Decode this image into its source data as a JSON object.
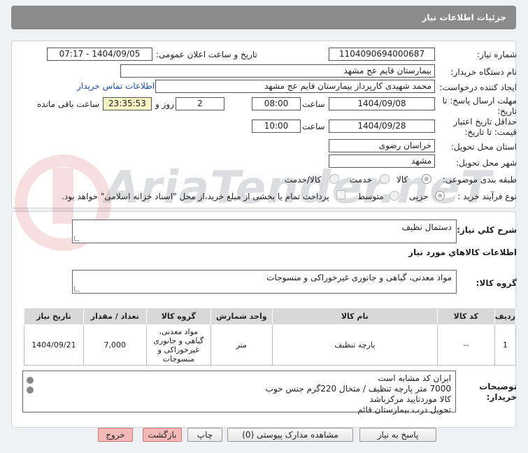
{
  "header": {
    "title": "جزئیات اطلاعات نیاز"
  },
  "form": {
    "need_number_label": "شماره نیاز:",
    "need_number": "1104090694000687",
    "announce_label": "تاریخ و ساعت اعلان عمومی:",
    "announce_value": "1404/09/05 - 07:17",
    "buyer_org_label": "نام دستگاه خریدار:",
    "buyer_org": "بیمارستان قایم  عج  مشهد",
    "creator_label": "ایجاد کننده درخواست:",
    "creator": "محمد شهیدی کارپرداز بیمارستان قایم  عج  مشهد",
    "contact_link": "اطلاعات تماس خریدار",
    "send_deadline_label_1": "مهلت ارسال پاسخ: تا",
    "send_deadline_label_2": "تاریخ:",
    "send_date": "1404/09/08",
    "time_label": "ساعت",
    "send_time": "08:00",
    "days_value": "2",
    "days_label": "روز و",
    "remaining_time": "23:35:53",
    "remaining_label": "ساعت باقی مانده",
    "validity_label_1": "حداقل تاریخ اعتبار",
    "validity_label_2": "قیمت: تا تاریخ:",
    "validity_date": "1404/09/28",
    "validity_time_label": "ساعت",
    "validity_time": "10:00",
    "province_label": "استان محل تحویل:",
    "province": "خراسان رضوی",
    "city_label": "شهر محل تحویل:",
    "city": "مشهد",
    "category_label": "طبقه بندی موضوعی:",
    "category_options": [
      "کالا",
      "خدمت",
      "کالا/خدمت"
    ],
    "process_label": "نوع فرآیند خرید :",
    "process_options": [
      "جزیی",
      "متوسط"
    ],
    "payment_note": "پرداخت تمام یا بخشی از مبلغ خرید،از محل \"اسناد خزانه اسلامی\" خواهد بود."
  },
  "summary": {
    "label": "شرح کلي نياز:",
    "value": "دستمال نظیف",
    "items_title": "اطلاعات کالاهاي مورد نياز",
    "group_label": "گروه کالا:",
    "group_value": "مواد معدنی، گیاهی و جانوری غیرخوراکی و منسوجات"
  },
  "table": {
    "headers": [
      "ردیف",
      "کد کالا",
      "نام کالا",
      "واحد شمارش",
      "گروه کالا",
      "تعداد / مقدار",
      "تاریخ نیاز"
    ],
    "rows": [
      [
        "1",
        "--",
        "پارچه تنظیف",
        "متر",
        "مواد معدنی، گیاهی و جانوری غیرخوراکی و منسوجات",
        "7,000",
        "1404/09/21"
      ]
    ]
  },
  "buyer_notes": {
    "label_1": "توضیحات",
    "label_2": "خریدار:",
    "lines": [
      "ایران کد مشابه است",
      "7000 متر پارچه  تنظیف / متخال 220گرم جنس خوب",
      "کالا موردتایید مرکزباشد",
      "تحویل درب بیمارستان قائم"
    ]
  },
  "buttons": {
    "reply": "پاسخ به نیاز",
    "docs": "مشاهده مدارک پیوستی (0)",
    "print": "چاپ",
    "back": "بازگشت",
    "exit": "خروج"
  },
  "colors": {
    "header_bg": "#8b8b8b",
    "exit_bg": "#f3b8b8",
    "link": "#1a4db3"
  }
}
